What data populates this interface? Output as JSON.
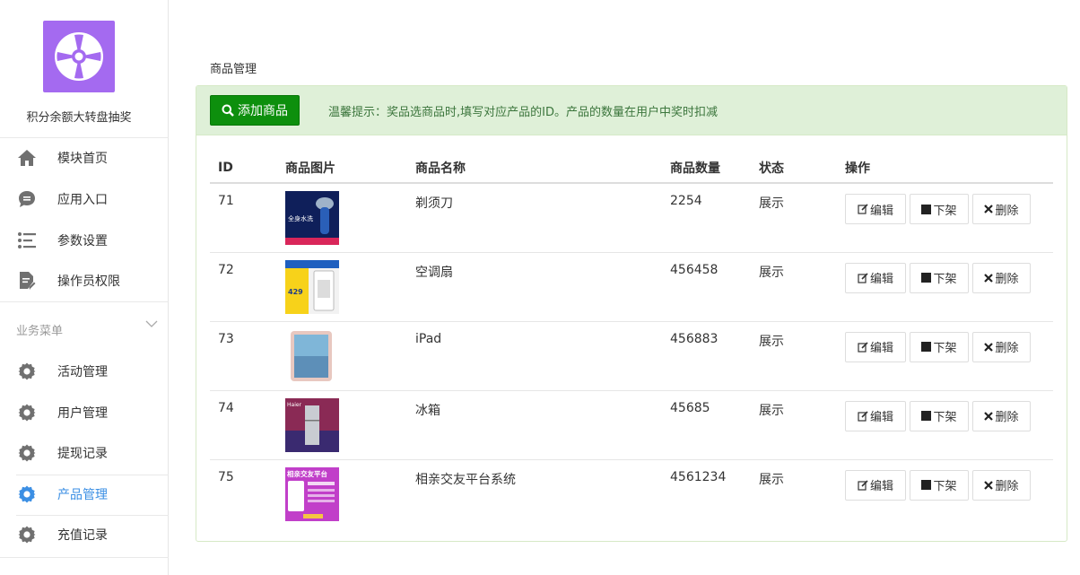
{
  "sidebar": {
    "app_title": "积分余额大转盘抽奖",
    "items": [
      {
        "label": "模块首页",
        "icon": "home-icon"
      },
      {
        "label": "应用入口",
        "icon": "chat-bubble-icon"
      },
      {
        "label": "参数设置",
        "icon": "list-settings-icon"
      },
      {
        "label": "操作员权限",
        "icon": "document-edit-icon"
      }
    ],
    "section_label": "业务菜单",
    "business_items": [
      {
        "label": "活动管理",
        "icon": "gear-icon"
      },
      {
        "label": "用户管理",
        "icon": "gear-icon"
      },
      {
        "label": "提现记录",
        "icon": "gear-icon"
      },
      {
        "label": "产品管理",
        "icon": "gear-icon",
        "active": true
      },
      {
        "label": "充值记录",
        "icon": "gear-icon"
      }
    ],
    "active_color": "#3b8fe4",
    "logo_color": "#a46af0"
  },
  "main": {
    "breadcrumb": "商品管理",
    "add_button": "添加商品",
    "tip": "温馨提示：奖品选商品时,填写对应产品的ID。产品的数量在用户中奖时扣减",
    "table": {
      "headers": [
        "ID",
        "商品图片",
        "商品名称",
        "商品数量",
        "状态",
        "操作"
      ],
      "rows": [
        {
          "id": "71",
          "name": "剃须刀",
          "qty": "2254",
          "status": "展示"
        },
        {
          "id": "72",
          "name": "空调扇",
          "qty": "456458",
          "status": "展示"
        },
        {
          "id": "73",
          "name": "iPad",
          "qty": "456883",
          "status": "展示"
        },
        {
          "id": "74",
          "name": "冰箱",
          "qty": "45685",
          "status": "展示"
        },
        {
          "id": "75",
          "name": "相亲交友平台系统",
          "qty": "4561234",
          "status": "展示"
        }
      ],
      "actions": {
        "edit": "编辑",
        "off_shelf": "下架",
        "delete": "删除"
      }
    },
    "thumb_texts": {
      "t71": "全身水洗",
      "t72": "429",
      "t74": "Haier",
      "t75": "相亲交友平台"
    }
  }
}
